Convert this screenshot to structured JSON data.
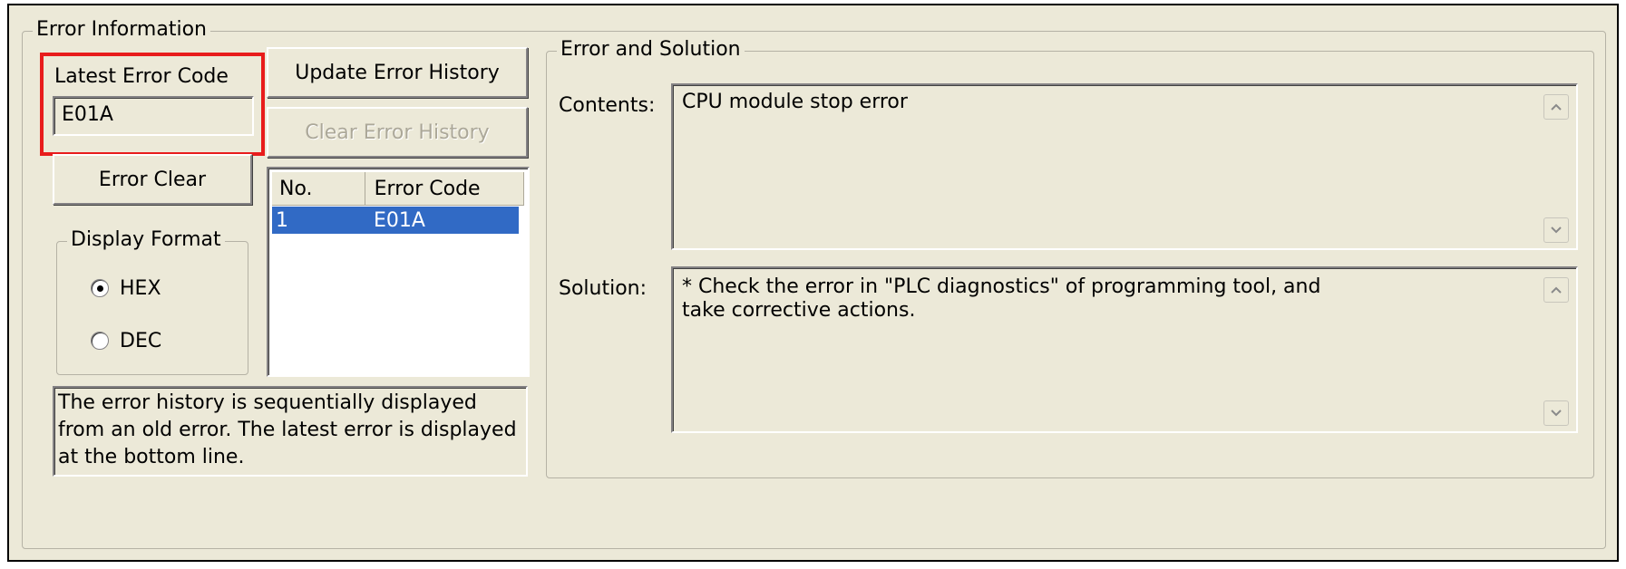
{
  "window": {
    "group_title": "Error Information"
  },
  "latest_error": {
    "label": "Latest Error Code",
    "value": "E01A",
    "highlight_color": "#e81c1c"
  },
  "buttons": {
    "update_history": "Update Error History",
    "clear_history": "Clear Error History",
    "error_clear": "Error Clear"
  },
  "history_table": {
    "columns": [
      "No.",
      "Error Code"
    ],
    "rows": [
      {
        "no": "1",
        "code": "E01A",
        "selected": true
      }
    ],
    "selection_color": "#316ac5"
  },
  "display_format": {
    "title": "Display Format",
    "options": [
      {
        "label": "HEX",
        "selected": true
      },
      {
        "label": "DEC",
        "selected": false
      }
    ]
  },
  "history_note": "The error history is sequentially displayed from an old error. The latest error is displayed at the bottom line.",
  "error_solution": {
    "title": "Error and Solution",
    "contents_label": "Contents:",
    "contents_text": "CPU module stop error",
    "solution_label": "Solution:",
    "solution_text": "* Check the error in \"PLC diagnostics\" of programming tool, and take corrective actions."
  },
  "icons": {
    "scroll_up": "scroll-up-arrow-icon",
    "scroll_down": "scroll-down-arrow-icon"
  }
}
